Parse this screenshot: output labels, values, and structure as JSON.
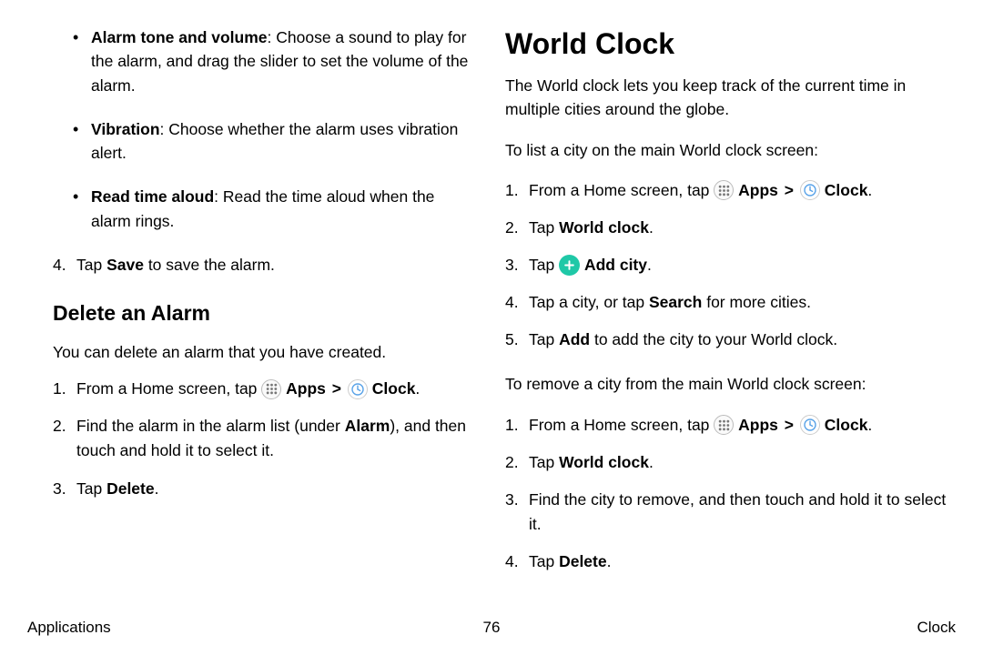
{
  "left": {
    "bullets": [
      {
        "label": "Alarm tone and volume",
        "desc": ": Choose a sound to play for the alarm, and drag the slider to set the volume of the alarm."
      },
      {
        "label": "Vibration",
        "desc": ": Choose whether the alarm uses vibration alert."
      },
      {
        "label": "Read time aloud",
        "desc": ": Read the time aloud when the alarm rings."
      }
    ],
    "step4_pre": "Tap ",
    "step4_bold": "Save",
    "step4_post": " to save the alarm.",
    "delete_heading": "Delete an Alarm",
    "delete_intro": "You can delete an alarm that you have created.",
    "del_step1_pre": "From a Home screen, tap ",
    "apps_label": "Apps",
    "clock_label": "Clock",
    "del_step2_a": "Find the alarm in the alarm list (under ",
    "del_step2_b": "Alarm",
    "del_step2_c": "), and then touch and hold it to select it.",
    "del_step3_pre": "Tap ",
    "del_step3_bold": "Delete",
    "period": "."
  },
  "right": {
    "heading": "World Clock",
    "intro": "The World clock lets you keep track of the current time in multiple cities around the globe.",
    "list_lead": "To list a city on the main World clock screen:",
    "step1_pre": "From a Home screen, tap ",
    "apps_label": "Apps",
    "clock_label": "Clock",
    "step2_pre": "Tap ",
    "step2_bold": "World clock",
    "step3_pre": "Tap ",
    "step3_bold": "Add city",
    "step4_a": "Tap a city, or tap ",
    "step4_b": "Search",
    "step4_c": " for more cities.",
    "step5_a": "Tap ",
    "step5_b": "Add",
    "step5_c": " to add the city to your World clock.",
    "remove_lead": "To remove a city from the main World clock screen:",
    "rstep3": "Find the city to remove, and then touch and hold it to select it.",
    "rstep4_pre": "Tap ",
    "rstep4_bold": "Delete",
    "period": "."
  },
  "footer": {
    "left": "Applications",
    "page": "76",
    "right": "Clock"
  }
}
